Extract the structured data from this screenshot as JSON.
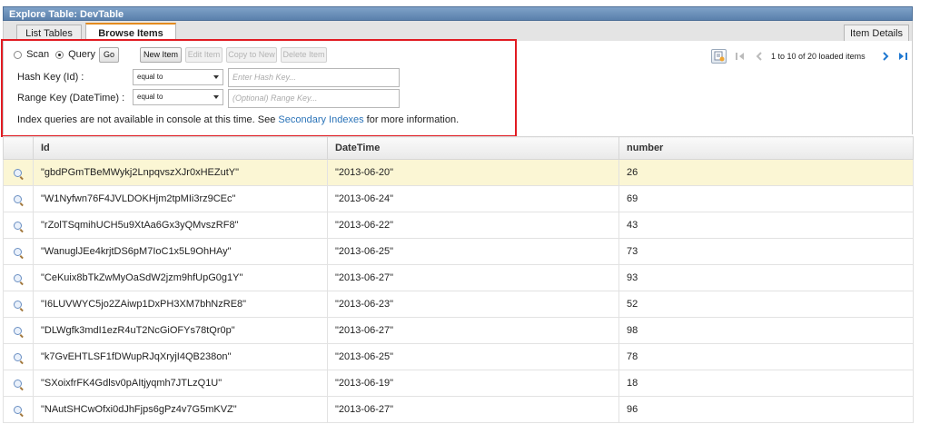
{
  "window": {
    "title": "Explore Table: DevTable"
  },
  "tabs": [
    {
      "label": "List Tables"
    },
    {
      "label": "Browse Items"
    },
    {
      "label": "Item Details"
    }
  ],
  "query": {
    "mode_scan": "Scan",
    "mode_query": "Query",
    "go": "Go",
    "new_item": "New Item",
    "edit_item": "Edit Item",
    "copy_to_new": "Copy to New",
    "delete_item": "Delete Item",
    "hash_key_label": "Hash Key (Id) :",
    "hash_operator": "equal to",
    "hash_placeholder": "Enter Hash Key...",
    "range_key_label": "Range Key (DateTime) :",
    "range_operator": "equal to",
    "range_placeholder": "(Optional) Range Key...",
    "note_prefix": "Index queries are not available in console at this time. See",
    "note_link": "Secondary Indexes",
    "note_suffix": "for more information."
  },
  "pager": {
    "status": "1 to 10 of 20 loaded items"
  },
  "table": {
    "columns": [
      "Id",
      "DateTime",
      "number"
    ],
    "rows": [
      {
        "id": "\"gbdPGmTBeMWykj2LnpqvszXJr0xHEZutY\"",
        "datetime": "\"2013-06-20\"",
        "number": "26"
      },
      {
        "id": "\"W1Nyfwn76F4JVLDOKHjm2tpMIi3rz9CEc\"",
        "datetime": "\"2013-06-24\"",
        "number": "69"
      },
      {
        "id": "\"rZolTSqmihUCH5u9XtAa6Gx3yQMvszRF8\"",
        "datetime": "\"2013-06-22\"",
        "number": "43"
      },
      {
        "id": "\"WanuglJEe4krjtDS6pM7IoC1x5L9OhHAy\"",
        "datetime": "\"2013-06-25\"",
        "number": "73"
      },
      {
        "id": "\"CeKuix8bTkZwMyOaSdW2jzm9hfUpG0g1Y\"",
        "datetime": "\"2013-06-27\"",
        "number": "93"
      },
      {
        "id": "\"I6LUVWYC5jo2ZAiwp1DxPH3XM7bhNzRE8\"",
        "datetime": "\"2013-06-23\"",
        "number": "52"
      },
      {
        "id": "\"DLWgfk3mdI1ezR4uT2NcGiOFYs78tQr0p\"",
        "datetime": "\"2013-06-27\"",
        "number": "98"
      },
      {
        "id": "\"k7GvEHTLSF1fDWupRJqXryjI4QB238on\"",
        "datetime": "\"2013-06-25\"",
        "number": "78"
      },
      {
        "id": "\"SXoixfrFK4Gdlsv0pAItjyqmh7JTLzQ1U\"",
        "datetime": "\"2013-06-19\"",
        "number": "18"
      },
      {
        "id": "\"NAutSHCwOfxi0dJhFjps6gPz4v7G5mKVZ\"",
        "datetime": "\"2013-06-27\"",
        "number": "96"
      }
    ]
  },
  "colors": {
    "accent_tab": "#e38b1f",
    "highlight_box": "#e11b22",
    "link": "#2a73b8",
    "selected_row": "#fbf6d4",
    "titlebar": "#5a80ac"
  }
}
